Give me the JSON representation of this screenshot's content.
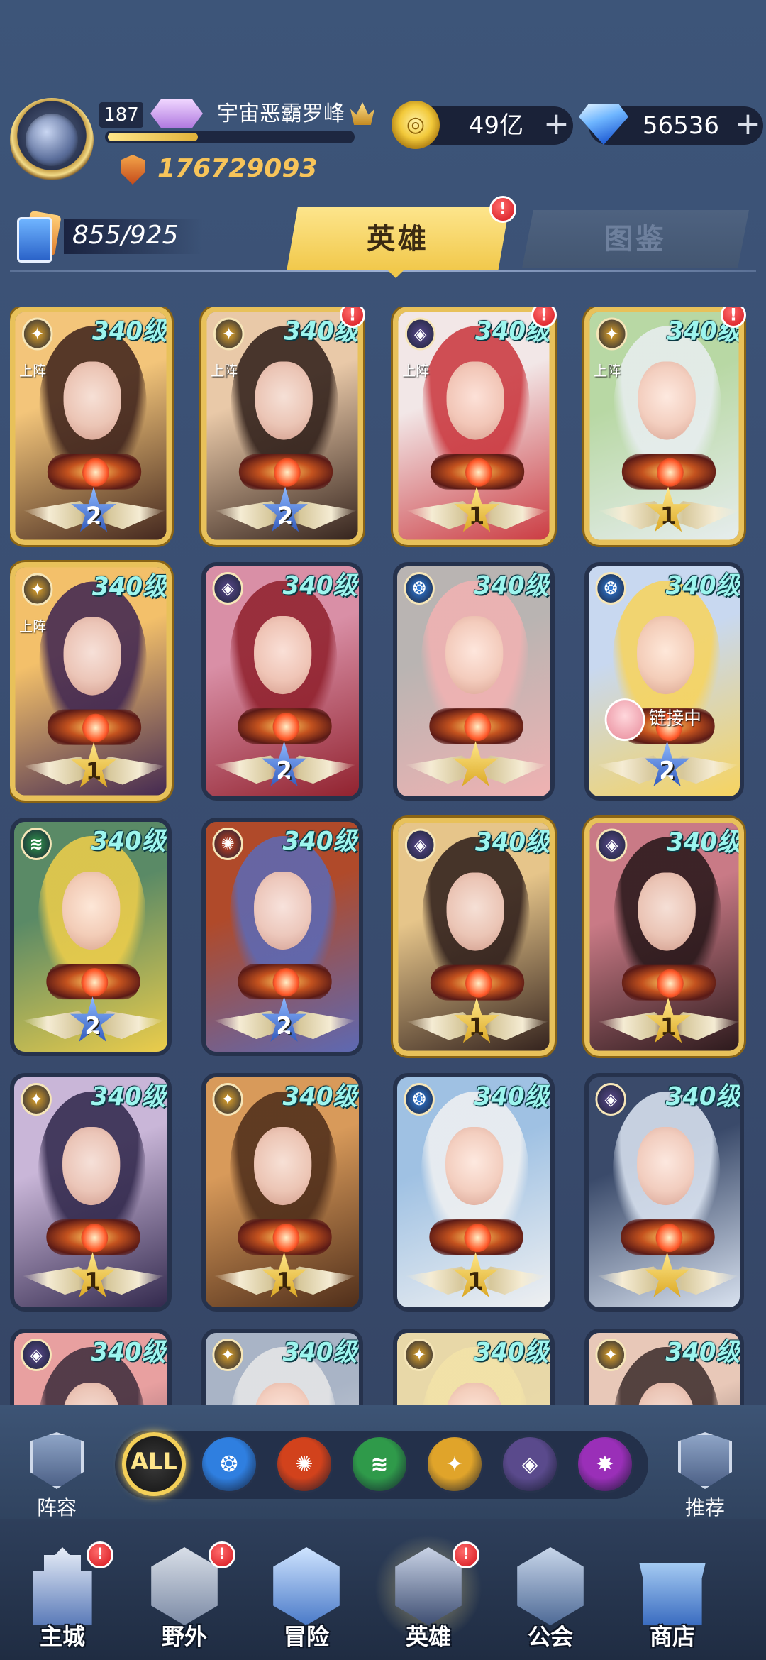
{
  "player": {
    "level": "187",
    "rank_badge": "",
    "name": "宇宙恶霸罗峰",
    "exp_fraction": 0.37,
    "power": "176729093"
  },
  "resources": {
    "gold": "49亿",
    "diamonds": "56536",
    "plus": "+"
  },
  "collection": {
    "count": "855/925"
  },
  "tabs": {
    "hero": "英雄",
    "atlas": "图鉴",
    "alert": "!"
  },
  "card_common": {
    "deployed_label": "上阵",
    "alert": "!"
  },
  "heroes": [
    {
      "level": "340级",
      "element": "light",
      "stars": "2",
      "star_color": "blue",
      "deployed": true,
      "alert": false,
      "gold": true
    },
    {
      "level": "340级",
      "element": "light",
      "stars": "2",
      "star_color": "blue",
      "deployed": true,
      "alert": true,
      "gold": true
    },
    {
      "level": "340级",
      "element": "dark",
      "stars": "1",
      "star_color": "gold",
      "deployed": true,
      "alert": true,
      "gold": true
    },
    {
      "level": "340级",
      "element": "light",
      "stars": "1",
      "star_color": "gold",
      "deployed": true,
      "alert": true,
      "gold": true
    },
    {
      "level": "340级",
      "element": "light",
      "stars": "1",
      "star_color": "gold",
      "deployed": true,
      "alert": false,
      "gold": true
    },
    {
      "level": "340级",
      "element": "dark",
      "stars": "2",
      "star_color": "blue",
      "deployed": false,
      "alert": false,
      "gold": false
    },
    {
      "level": "340级",
      "element": "water",
      "stars": "",
      "star_color": "gold",
      "deployed": false,
      "alert": false,
      "gold": false
    },
    {
      "level": "340级",
      "element": "water",
      "stars": "2",
      "star_color": "blue",
      "deployed": false,
      "alert": false,
      "gold": false,
      "link": "链接中"
    },
    {
      "level": "340级",
      "element": "wind",
      "stars": "2",
      "star_color": "blue",
      "deployed": false,
      "alert": false,
      "gold": false
    },
    {
      "level": "340级",
      "element": "fire",
      "stars": "2",
      "star_color": "blue",
      "deployed": false,
      "alert": false,
      "gold": false
    },
    {
      "level": "340级",
      "element": "dark",
      "stars": "1",
      "star_color": "gold",
      "deployed": false,
      "alert": false,
      "gold": true
    },
    {
      "level": "340级",
      "element": "dark",
      "stars": "1",
      "star_color": "gold",
      "deployed": false,
      "alert": false,
      "gold": true
    },
    {
      "level": "340级",
      "element": "light",
      "stars": "1",
      "star_color": "gold",
      "deployed": false,
      "alert": false,
      "gold": false
    },
    {
      "level": "340级",
      "element": "light",
      "stars": "1",
      "star_color": "gold",
      "deployed": false,
      "alert": false,
      "gold": false
    },
    {
      "level": "340级",
      "element": "water",
      "stars": "1",
      "star_color": "gold",
      "deployed": false,
      "alert": false,
      "gold": false
    },
    {
      "level": "340级",
      "element": "dark",
      "stars": "",
      "star_color": "gold",
      "deployed": false,
      "alert": false,
      "gold": false
    },
    {
      "level": "340级",
      "element": "dark",
      "stars": "",
      "star_color": "gold",
      "deployed": false,
      "alert": false,
      "gold": false
    },
    {
      "level": "340级",
      "element": "light",
      "stars": "",
      "star_color": "gold",
      "deployed": false,
      "alert": false,
      "gold": false
    },
    {
      "level": "340级",
      "element": "light",
      "stars": "",
      "star_color": "gold",
      "deployed": false,
      "alert": false,
      "gold": false
    },
    {
      "level": "340级",
      "element": "light",
      "stars": "",
      "star_color": "gold",
      "deployed": false,
      "alert": false,
      "gold": false
    }
  ],
  "element_colors": {
    "light": "#e0a42a",
    "dark": "#5a4a8c",
    "water": "#2f7fe0",
    "wind": "#2f9a4a",
    "fire": "#d2421c",
    "chaos": "#9a2fb8"
  },
  "filters": {
    "formation": "阵容",
    "recommend": "推荐",
    "all": "ALL",
    "elements": [
      "water",
      "fire",
      "wind",
      "light",
      "dark",
      "chaos"
    ]
  },
  "nav": {
    "items": [
      {
        "label": "主城",
        "alert": true
      },
      {
        "label": "野外",
        "alert": true
      },
      {
        "label": "冒险",
        "alert": false
      },
      {
        "label": "英雄",
        "alert": true,
        "active": true
      },
      {
        "label": "公会",
        "alert": false
      },
      {
        "label": "商店",
        "alert": false
      }
    ]
  }
}
